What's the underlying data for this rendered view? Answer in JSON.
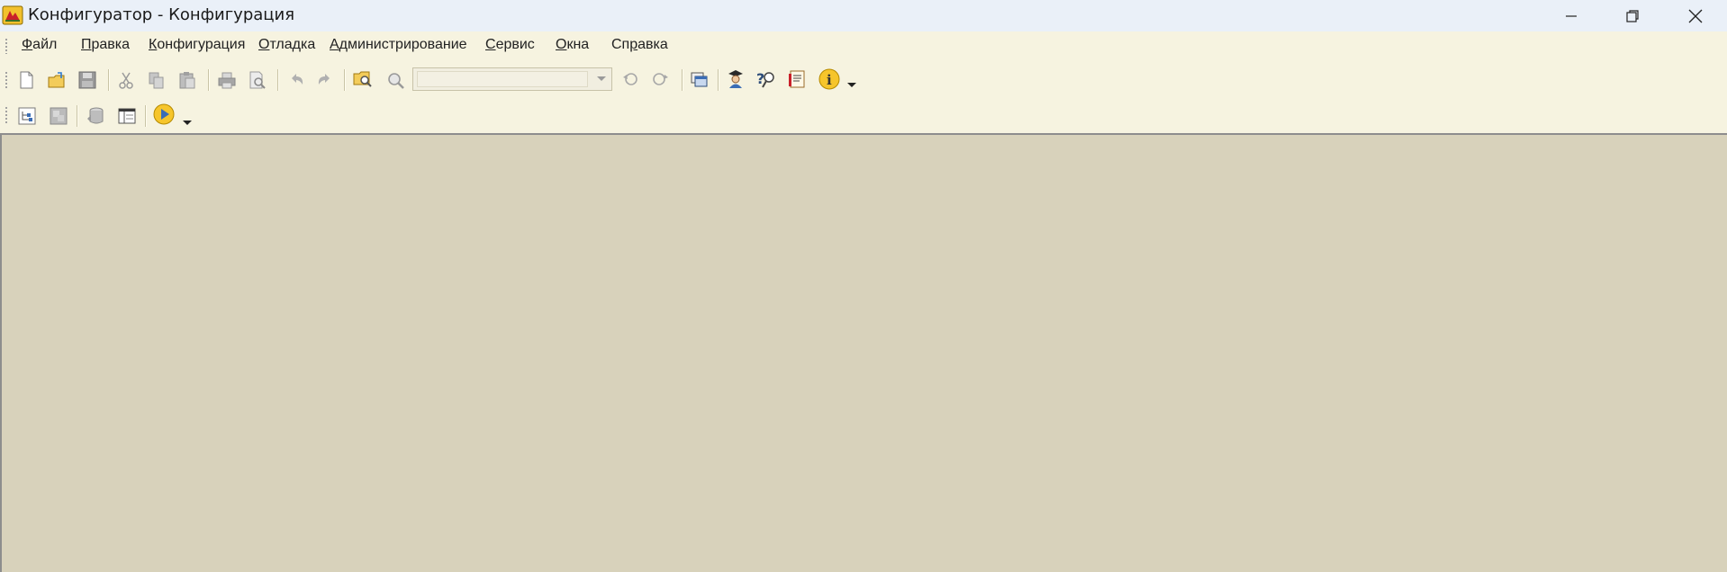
{
  "window": {
    "title": "Конфигуратор - Конфигурация",
    "controls": [
      "minimize-icon",
      "restore-icon",
      "close-icon"
    ]
  },
  "menu": {
    "items": [
      {
        "label": "Файл",
        "underline": "Ф"
      },
      {
        "label": "Правка",
        "underline": "П"
      },
      {
        "label": "Конфигурация",
        "underline": "К"
      },
      {
        "label": "Отладка",
        "underline": "О"
      },
      {
        "label": "Администрирование",
        "underline": "А"
      },
      {
        "label": "Сервис",
        "underline": "С"
      },
      {
        "label": "Окна",
        "underline": "О"
      },
      {
        "label": "Справка",
        "underline": "р"
      }
    ]
  },
  "toolbar1": {
    "search_value": "",
    "icons": [
      "new-document-icon",
      "open-folder-icon",
      "save-icon",
      "cut-icon",
      "copy-icon",
      "paste-icon",
      "print-icon",
      "print-preview-icon",
      "undo-icon",
      "redo-icon",
      "find-in-files-icon",
      "search-icon",
      "find-next-icon",
      "find-previous-icon",
      "windows-icon",
      "syntax-assistant-icon",
      "search-help-icon",
      "help-contents-icon",
      "info-icon",
      "toolbar-overflow-icon"
    ]
  },
  "toolbar2": {
    "icons": [
      "configuration-tree-icon",
      "database-config-icon",
      "update-database-icon",
      "properties-panel-icon",
      "start-debug-icon",
      "toolbar-overflow-icon"
    ]
  },
  "colors": {
    "titlebar": "#eaf0f8",
    "chrome": "#f6f3e0",
    "workspace": "#d8d2bb"
  }
}
